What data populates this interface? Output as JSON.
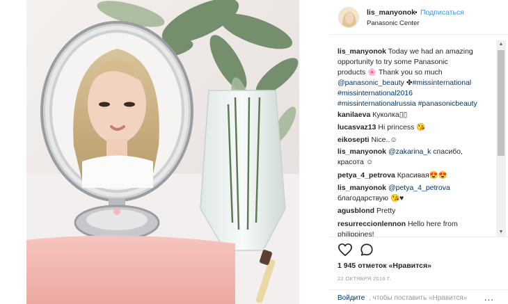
{
  "post": {
    "image_alt": "Selfie in a vintage hand mirror next to a vase of greenery"
  },
  "header": {
    "username": "lis_manyonok",
    "dot": "•",
    "follow_label": "Подписаться",
    "location": "Panasonic Center"
  },
  "caption": {
    "username": "lis_manyonok",
    "line1": " Today we had an amazing",
    "line2": "opportunity to try some Panasonic",
    "line3": "products 🌸 Thank you so much",
    "mention1": "@panasonic_beauty",
    "line4_mid": " ✤",
    "tag1": "#missinternational",
    "tag2": "#missinternational2016",
    "tag3": "#missinternationalrussia",
    "tag4": "#panasonicbeauty"
  },
  "comments": [
    {
      "user": "kanilaeva",
      "text": " Куколка▯▯"
    },
    {
      "user": "lucasvaz13",
      "text": " Hi princess 😘"
    },
    {
      "user": "eikosepti",
      "text": " Nice..☺"
    },
    {
      "user": "lis_manyonok",
      "mention": "@zakarina_k",
      "text": " спасибо,",
      "line2": "красота ☺"
    },
    {
      "user": "petya_4_petrova",
      "text": " Красивая😍😍"
    },
    {
      "user": "lis_manyonok",
      "mention": "@petya_4_petrova",
      "text": "",
      "line2": "благодарствую 😘♥"
    },
    {
      "user": "agusblond",
      "text": " Pretty"
    },
    {
      "user": "resurreccionlennon",
      "text": " Hello here from",
      "line2": "philippines!"
    }
  ],
  "scrollbar": {
    "up": "▲",
    "down": "▼"
  },
  "actions": {
    "heart_icon": "heart-outline",
    "comment_icon": "speech-bubble-outline"
  },
  "likes": "1 945 отметок «Нравится»",
  "date": "22 ОКТЯБРЯ 2016 Г.",
  "login": {
    "link": "Войдите",
    "text": ", чтобы поставить «Нравится»",
    "more": "..."
  },
  "colors": {
    "link_blue": "#3897f0",
    "mention_blue": "#003569",
    "text": "#262626",
    "muted": "#999999"
  }
}
